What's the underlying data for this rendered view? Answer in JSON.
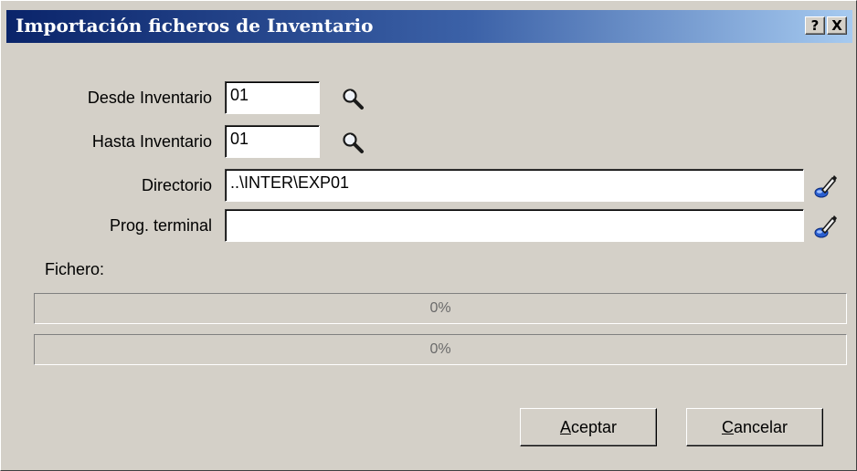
{
  "window": {
    "title": "Importación ficheros de Inventario",
    "help_label": "?",
    "close_label": "X"
  },
  "form": {
    "desde_label": "Desde Inventario",
    "desde_value": "01",
    "hasta_label": "Hasta Inventario",
    "hasta_value": "01",
    "directorio_label": "Directorio",
    "directorio_value": "..\\INTER\\EXP01",
    "prog_label": "Prog. terminal",
    "prog_value": "",
    "fichero_label": "Fichero:"
  },
  "progress": [
    {
      "percent": 0,
      "label": "0%"
    },
    {
      "percent": 0,
      "label": "0%"
    }
  ],
  "buttons": {
    "aceptar_accel": "A",
    "aceptar_rest": "ceptar",
    "cancelar_accel": "C",
    "cancelar_rest": "ancelar"
  },
  "icons": {
    "lookup": "magnifier-icon",
    "browse": "edit-browse-icon"
  },
  "colors": {
    "face": "#d4d0c8",
    "title_start": "#0a246a",
    "title_end": "#a6caf0"
  }
}
